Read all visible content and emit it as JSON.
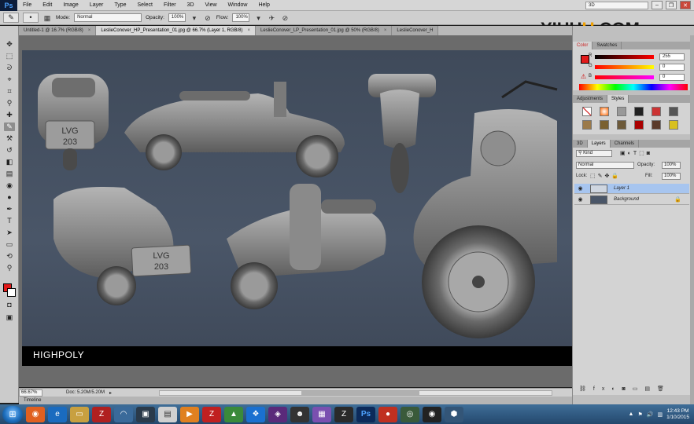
{
  "app": {
    "logo": "Ps",
    "menu": [
      "File",
      "Edit",
      "Image",
      "Layer",
      "Type",
      "Select",
      "Filter",
      "3D",
      "View",
      "Window",
      "Help"
    ],
    "workspace": "3D"
  },
  "options_bar": {
    "mode_label": "Mode:",
    "mode_value": "Normal",
    "opacity_label": "Opacity:",
    "opacity_value": "100%",
    "flow_label": "Flow:",
    "flow_value": "100%"
  },
  "watermark": {
    "pre": "YI",
    "mid": "HU",
    "u": "U",
    "post": ".COM"
  },
  "tabs": [
    {
      "label": "Untitled-1 @ 16.7% (RGB/8)",
      "active": false
    },
    {
      "label": "LeslieConover_HP_Presentation_01.jpg @ 66.7% (Layer 1, RGB/8)",
      "active": true
    },
    {
      "label": "LeslieConover_LP_Presentation_01.jpg @ 50% (RGB/8)",
      "active": false
    },
    {
      "label": "LeslieConover_H",
      "active": false
    }
  ],
  "canvas": {
    "caption": "HIGHPOLY",
    "plate_text_1": "LVG\n203",
    "plate_text_2": "LVG\n203"
  },
  "status": {
    "zoom": "66.67%",
    "doc": "Doc: 5.20M/5.20M",
    "timeline": "Timeline"
  },
  "color_panel": {
    "tabs": [
      "Color",
      "Swatches"
    ],
    "r_value": "255",
    "g_value": "0",
    "b_value": "0"
  },
  "styles_panel": {
    "tabs": [
      "Adjustments",
      "Styles"
    ]
  },
  "layers_panel": {
    "tabs": [
      "3D",
      "Layers",
      "Channels"
    ],
    "kind": "Kind",
    "blend": "Normal",
    "opacity_label": "Opacity:",
    "opacity_value": "100%",
    "lock_label": "Lock:",
    "fill_label": "Fill:",
    "fill_value": "100%",
    "layers": [
      {
        "name": "Layer 1",
        "selected": true
      },
      {
        "name": "Background",
        "selected": false
      }
    ]
  },
  "taskbar": {
    "time": "12:43 PM",
    "date": "1/10/2015"
  }
}
